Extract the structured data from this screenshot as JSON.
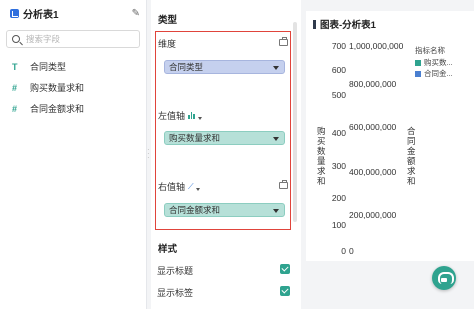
{
  "left_panel": {
    "dataset_title": "分析表1",
    "search_placeholder": "搜索字段",
    "fields": [
      {
        "type_icon": "T",
        "label": "合同类型"
      },
      {
        "type_icon": "#",
        "label": "购买数量求和"
      },
      {
        "type_icon": "#",
        "label": "合同金额求和"
      }
    ]
  },
  "config_panel": {
    "type_section": "类型",
    "dimension": {
      "label": "维度",
      "value": "合同类型"
    },
    "left_axis": {
      "label": "左值轴",
      "value": "购买数量求和"
    },
    "right_axis": {
      "label": "右值轴",
      "value": "合同金额求和"
    },
    "style_section": "样式",
    "options": [
      {
        "label": "显示标题",
        "checked": true
      },
      {
        "label": "显示标签",
        "checked": true
      }
    ]
  },
  "chart": {
    "title": "图表-分析表1",
    "legend_title": "指标名称",
    "colors": {
      "series1": "#2fa38f",
      "series2": "#4a7fd0"
    }
  },
  "chart_data": {
    "type": "bar",
    "title": "图表-分析表1",
    "categories": [],
    "series": [
      {
        "name": "购买数...",
        "axis": "left",
        "values": []
      },
      {
        "name": "合同金...",
        "axis": "right",
        "values": []
      }
    ],
    "left_axis": {
      "label": "购买数量求和",
      "ticks": [
        "700",
        "600",
        "500",
        "400",
        "300",
        "200",
        "100",
        "0"
      ],
      "ylim": [
        0,
        700
      ]
    },
    "right_axis": {
      "label": "合同金额求和",
      "ticks": [
        "1,000,000,000",
        "800,000,000",
        "600,000,000",
        "400,000,000",
        "200,000,000",
        "0"
      ],
      "ylim": [
        0,
        1000000000
      ]
    },
    "legend_position": "top-right"
  }
}
